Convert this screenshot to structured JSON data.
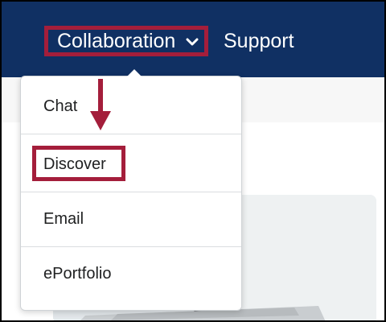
{
  "nav": {
    "items": [
      {
        "label": "Collaboration"
      },
      {
        "label": "Support"
      }
    ]
  },
  "dropdown": {
    "items": [
      {
        "label": "Chat"
      },
      {
        "label": "Discover"
      },
      {
        "label": "Email"
      },
      {
        "label": "ePortfolio"
      }
    ]
  },
  "colors": {
    "navbar": "#103063",
    "highlight": "#a41e3b",
    "text": "#202122"
  },
  "icons": {
    "chevron": "chevron-down-icon",
    "arrow": "arrow-down-icon"
  }
}
